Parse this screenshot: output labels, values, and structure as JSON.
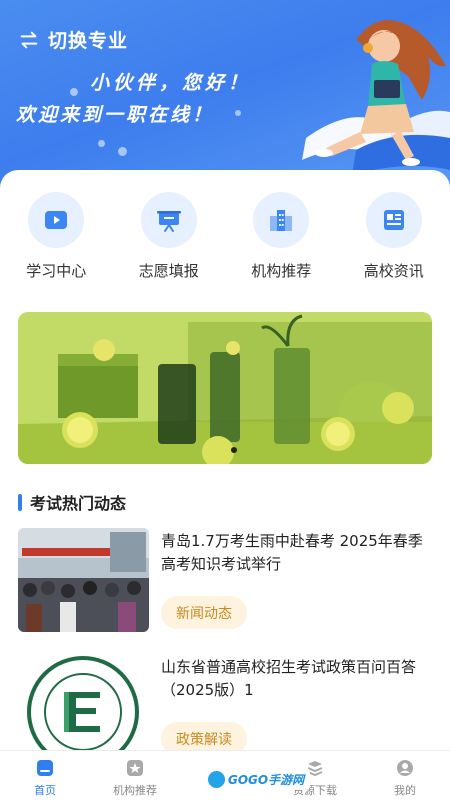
{
  "header": {
    "switch_label": "切换专业",
    "greeting_line1": "小伙伴，您好！",
    "greeting_line2": "欢迎来到一职在线！"
  },
  "quick_links": [
    {
      "label": "学习中心",
      "icon": "play-video-icon"
    },
    {
      "label": "志愿填报",
      "icon": "presentation-board-icon"
    },
    {
      "label": "机构推荐",
      "icon": "buildings-icon"
    },
    {
      "label": "高校资讯",
      "icon": "newspaper-icon"
    }
  ],
  "section": {
    "title": "考试热门动态"
  },
  "news": [
    {
      "title": "青岛1.7万考生雨中赴春考 2025年春季高考知识考试举行",
      "tag": "新闻动态"
    },
    {
      "title": "山东省普通高校招生考试政策百问百答 （2025版）1",
      "tag": "政策解读"
    }
  ],
  "tabbar": [
    {
      "label": "首页",
      "icon": "home-icon",
      "active": true
    },
    {
      "label": "机构推荐",
      "icon": "institution-icon",
      "active": false
    },
    {
      "label": "",
      "icon": "center-icon",
      "active": false
    },
    {
      "label": "资源下载",
      "icon": "download-icon",
      "active": false
    },
    {
      "label": "我的",
      "icon": "user-icon",
      "active": false
    }
  ],
  "watermark": {
    "text": "GOGO手游网"
  },
  "colors": {
    "primary": "#2f7ff0",
    "hero": "#4a8df0",
    "tag_bg": "#fdf3df",
    "tag_text": "#c98a21"
  }
}
